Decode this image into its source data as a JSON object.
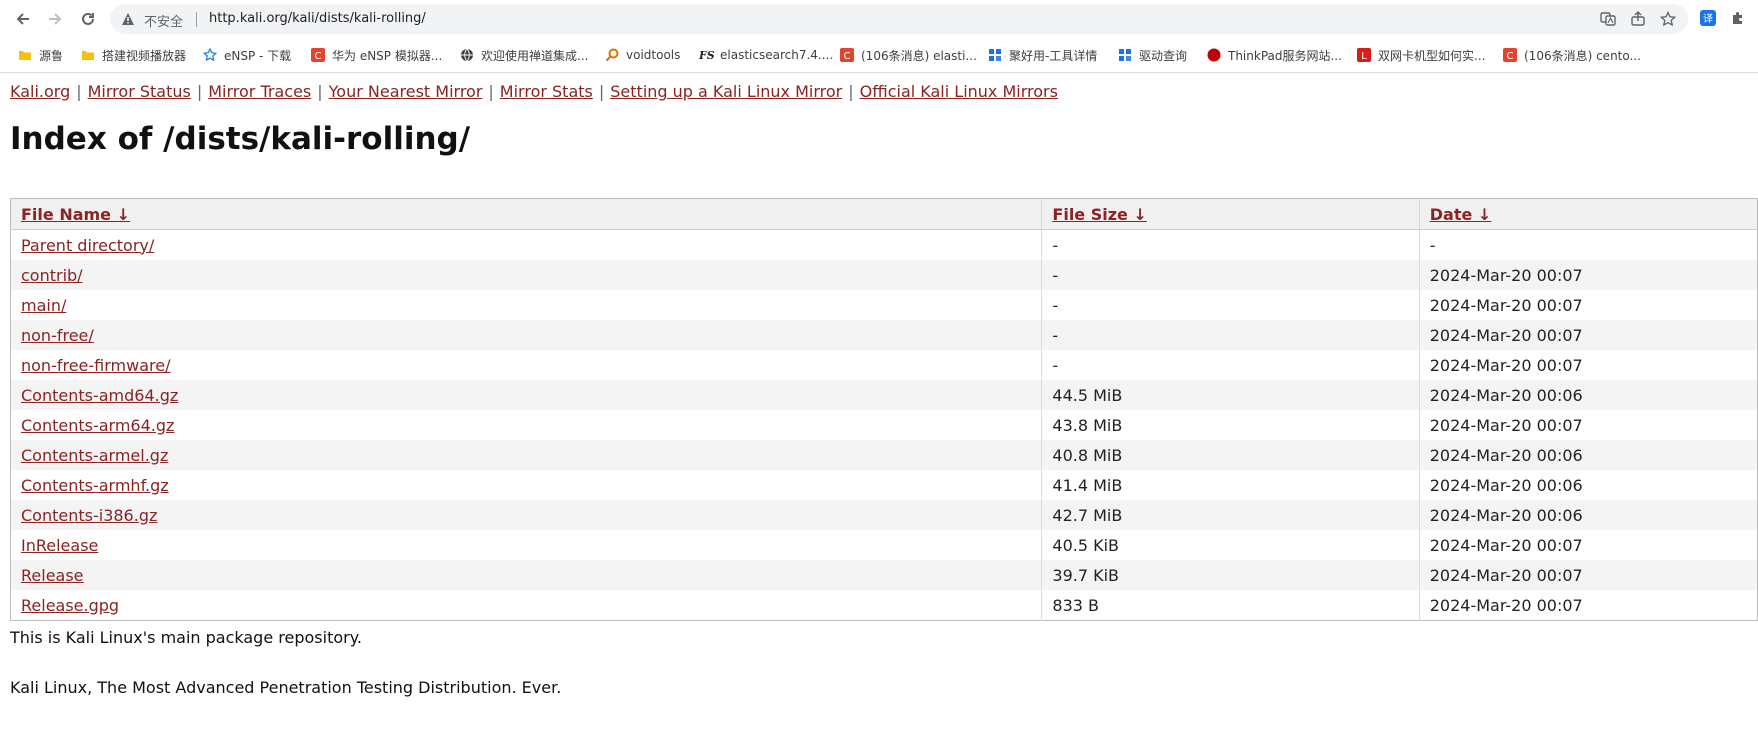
{
  "browser": {
    "security_label": "不安全",
    "url": "http.kali.org/kali/dists/kali-rolling/",
    "bookmarks": [
      {
        "label": "源鲁",
        "icon": "folder-icon"
      },
      {
        "label": "搭建视频播放器",
        "icon": "folder-icon"
      },
      {
        "label": "eNSP - 下载",
        "icon": "star-favicon-icon"
      },
      {
        "label": "华为 eNSP 模拟器...",
        "icon": "csdn-favicon-icon"
      },
      {
        "label": "欢迎使用禅道集成...",
        "icon": "globe-favicon-icon"
      },
      {
        "label": "voidtools",
        "icon": "magnifier-favicon-icon"
      },
      {
        "label": "elasticsearch7.4....",
        "icon": "fs-favicon-icon"
      },
      {
        "label": "(106条消息) elasti...",
        "icon": "csdn-favicon-icon"
      },
      {
        "label": "聚好用-工具详情",
        "icon": "jhy-favicon-icon"
      },
      {
        "label": "驱动查询",
        "icon": "jhy-favicon-icon"
      },
      {
        "label": "ThinkPad服务网站...",
        "icon": "red-dot-favicon-icon"
      },
      {
        "label": "双网卡机型如何实...",
        "icon": "lenovo-favicon-icon"
      },
      {
        "label": "(106条消息) cento...",
        "icon": "csdn-favicon-icon"
      }
    ],
    "colors": {
      "link": "#8b2323",
      "csdn": "#e2452f",
      "jhy": "#1a73e8"
    }
  },
  "page": {
    "topnav": [
      "Kali.org",
      "Mirror Status",
      "Mirror Traces",
      "Your Nearest Mirror",
      "Mirror Stats",
      "Setting up a Kali Linux Mirror",
      "Official Kali Linux Mirrors"
    ],
    "nav_separator": "|",
    "title": "Index of /dists/kali-rolling/",
    "table": {
      "headers": [
        "File Name  ↓",
        "File Size  ↓",
        "Date  ↓"
      ],
      "rows": [
        {
          "name": "Parent directory/",
          "size": "-",
          "date": "-"
        },
        {
          "name": "contrib/",
          "size": "-",
          "date": "2024-Mar-20 00:07"
        },
        {
          "name": "main/",
          "size": "-",
          "date": "2024-Mar-20 00:07"
        },
        {
          "name": "non-free/",
          "size": "-",
          "date": "2024-Mar-20 00:07"
        },
        {
          "name": "non-free-firmware/",
          "size": "-",
          "date": "2024-Mar-20 00:07"
        },
        {
          "name": "Contents-amd64.gz",
          "size": "44.5 MiB",
          "date": "2024-Mar-20 00:06"
        },
        {
          "name": "Contents-arm64.gz",
          "size": "43.8 MiB",
          "date": "2024-Mar-20 00:07"
        },
        {
          "name": "Contents-armel.gz",
          "size": "40.8 MiB",
          "date": "2024-Mar-20 00:06"
        },
        {
          "name": "Contents-armhf.gz",
          "size": "41.4 MiB",
          "date": "2024-Mar-20 00:06"
        },
        {
          "name": "Contents-i386.gz",
          "size": "42.7 MiB",
          "date": "2024-Mar-20 00:06"
        },
        {
          "name": "InRelease",
          "size": "40.5 KiB",
          "date": "2024-Mar-20 00:07"
        },
        {
          "name": "Release",
          "size": "39.7 KiB",
          "date": "2024-Mar-20 00:07"
        },
        {
          "name": "Release.gpg",
          "size": "833 B",
          "date": "2024-Mar-20 00:07"
        }
      ]
    },
    "footer_line1": "This is Kali Linux's main package repository.",
    "footer_line2": "Kali Linux, The Most Advanced Penetration Testing Distribution. Ever."
  }
}
